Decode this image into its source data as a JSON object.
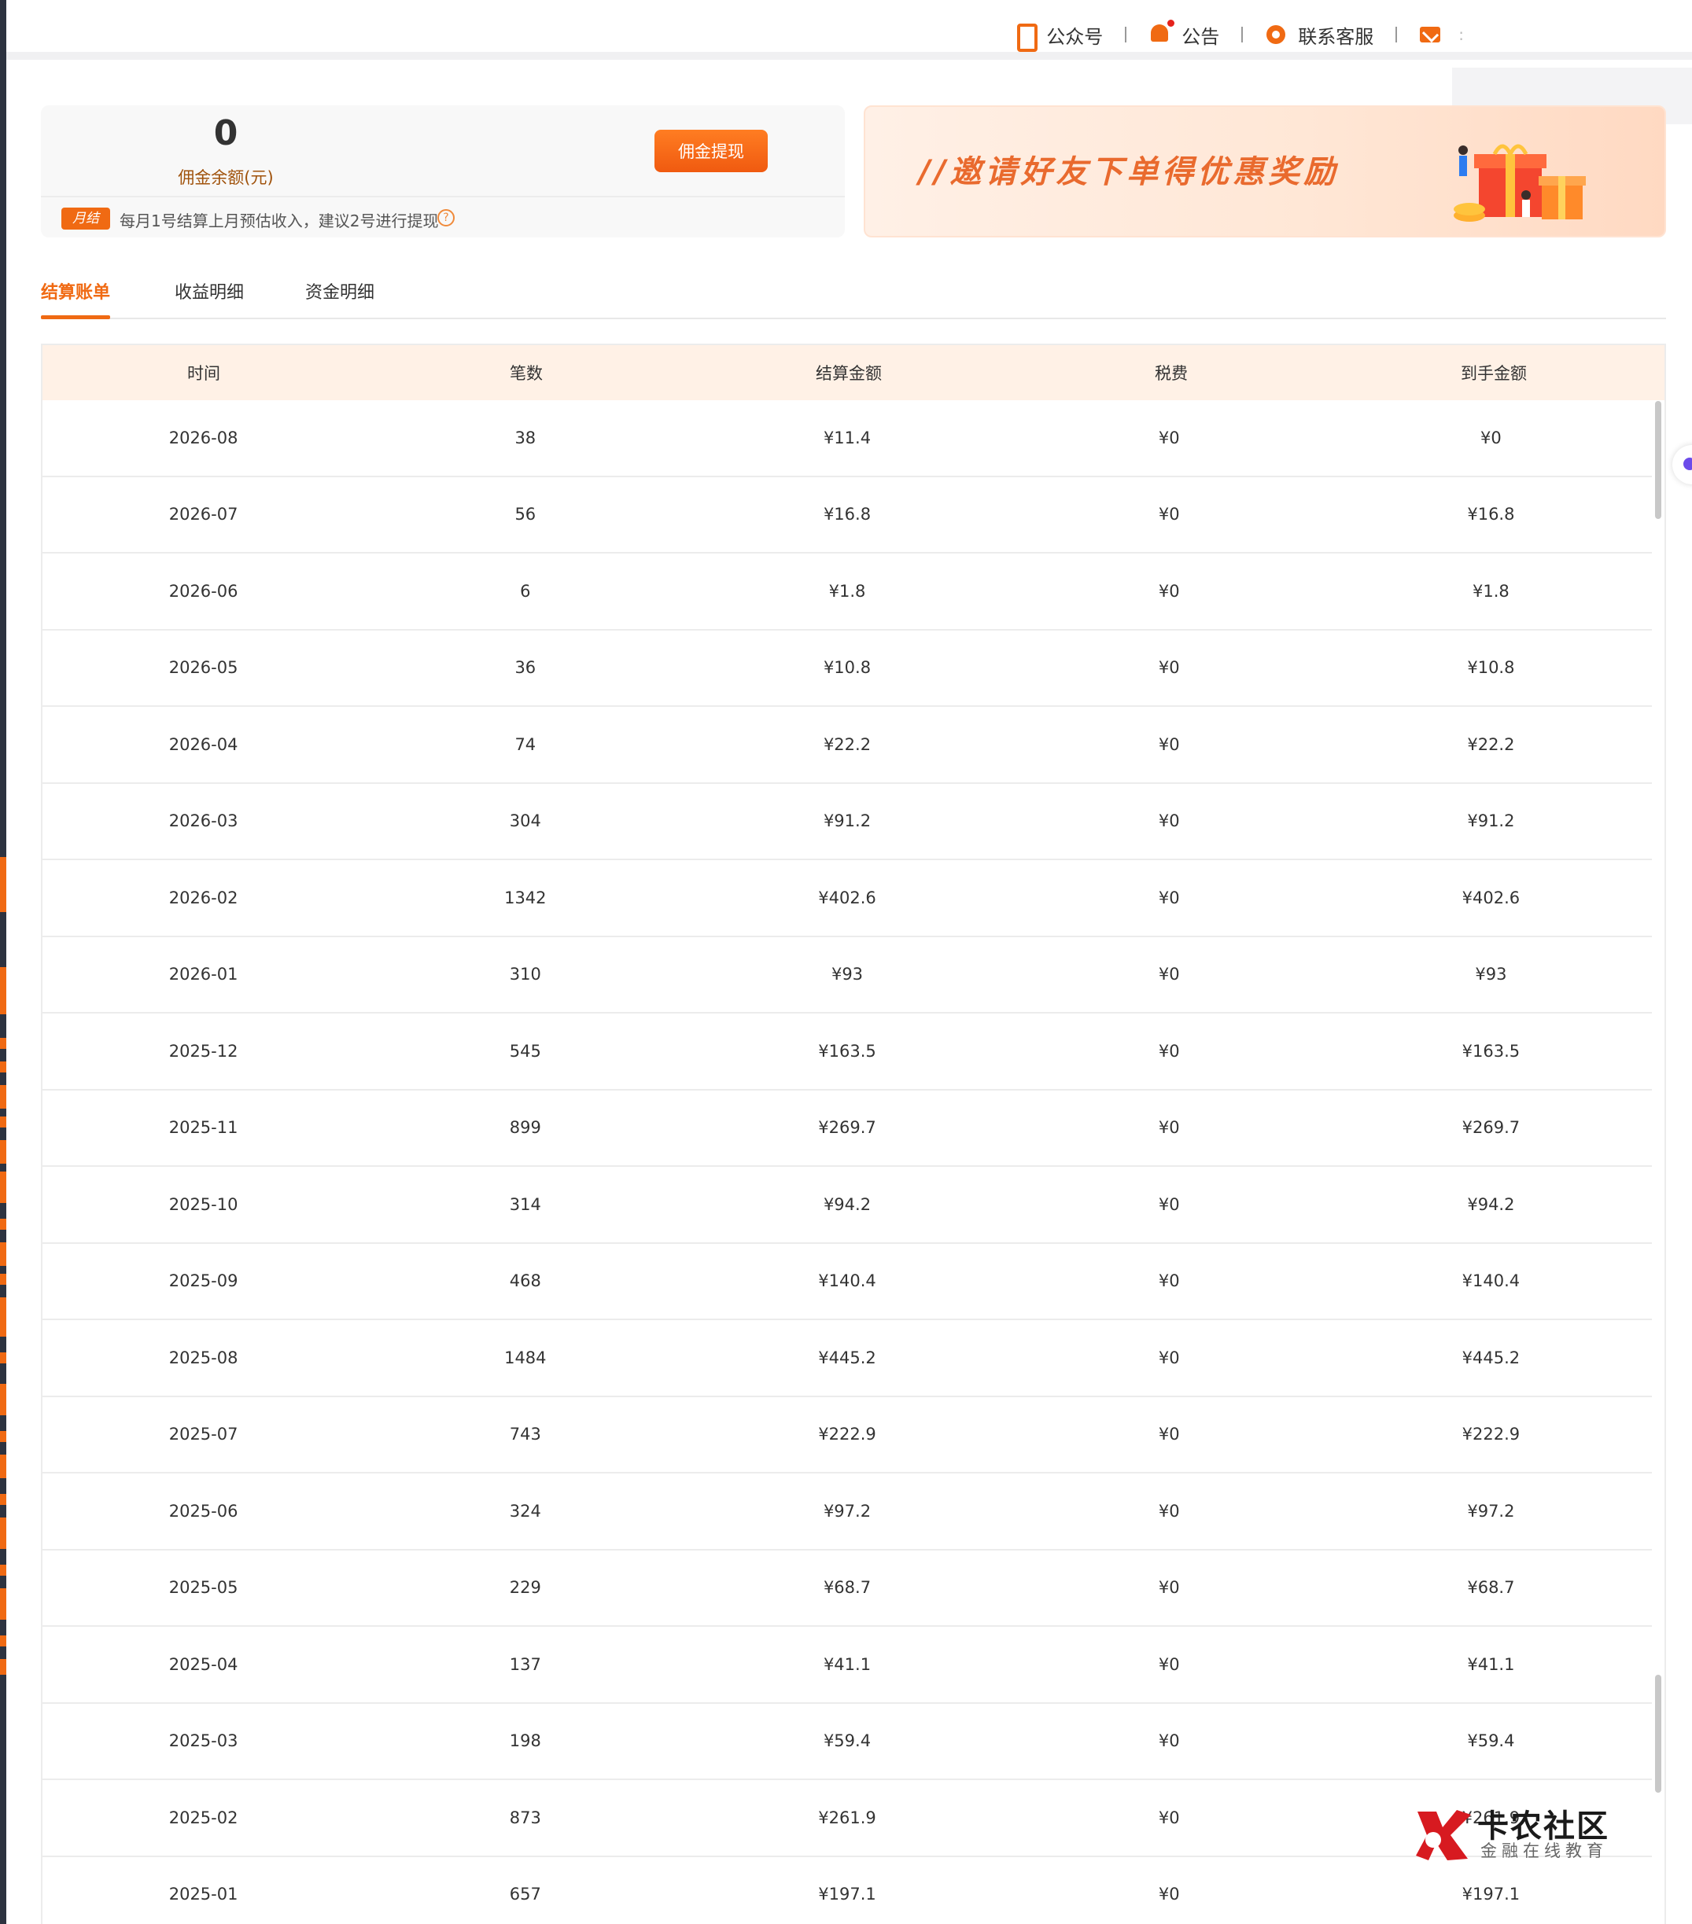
{
  "topnav": {
    "items": [
      {
        "label": "公众号",
        "icon": "phone-icon"
      },
      {
        "label": "公告",
        "icon": "bell-icon"
      },
      {
        "label": "联系客服",
        "icon": "customer-service-icon"
      },
      {
        "label": "",
        "icon": "mail-icon"
      }
    ],
    "trailing": ":"
  },
  "commission": {
    "balance": "0",
    "balance_label": "佣金余额(元)",
    "withdraw_label": "佣金提现",
    "monthly_tag": "月结",
    "monthly_note": "每月1号结算上月预估收入，建议2号进行提现",
    "help_symbol": "?"
  },
  "promo": {
    "text": "//邀请好友下单得优惠奖励"
  },
  "tabs": [
    {
      "label": "结算账单",
      "active": true
    },
    {
      "label": "收益明细",
      "active": false
    },
    {
      "label": "资金明细",
      "active": false
    }
  ],
  "table": {
    "headers": [
      "时间",
      "笔数",
      "结算金额",
      "税费",
      "到手金额"
    ],
    "rows": [
      [
        "2026-08",
        "38",
        "¥11.4",
        "¥0",
        "¥0"
      ],
      [
        "2026-07",
        "56",
        "¥16.8",
        "¥0",
        "¥16.8"
      ],
      [
        "2026-06",
        "6",
        "¥1.8",
        "¥0",
        "¥1.8"
      ],
      [
        "2026-05",
        "36",
        "¥10.8",
        "¥0",
        "¥10.8"
      ],
      [
        "2026-04",
        "74",
        "¥22.2",
        "¥0",
        "¥22.2"
      ],
      [
        "2026-03",
        "304",
        "¥91.2",
        "¥0",
        "¥91.2"
      ],
      [
        "2026-02",
        "1342",
        "¥402.6",
        "¥0",
        "¥402.6"
      ],
      [
        "2026-01",
        "310",
        "¥93",
        "¥0",
        "¥93"
      ],
      [
        "2025-12",
        "545",
        "¥163.5",
        "¥0",
        "¥163.5"
      ],
      [
        "2025-11",
        "899",
        "¥269.7",
        "¥0",
        "¥269.7"
      ],
      [
        "2025-10",
        "314",
        "¥94.2",
        "¥0",
        "¥94.2"
      ],
      [
        "2025-09",
        "468",
        "¥140.4",
        "¥0",
        "¥140.4"
      ],
      [
        "2025-08",
        "1484",
        "¥445.2",
        "¥0",
        "¥445.2"
      ],
      [
        "2025-07",
        "743",
        "¥222.9",
        "¥0",
        "¥222.9"
      ],
      [
        "2025-06",
        "324",
        "¥97.2",
        "¥0",
        "¥97.2"
      ],
      [
        "2025-05",
        "229",
        "¥68.7",
        "¥0",
        "¥68.7"
      ],
      [
        "2025-04",
        "137",
        "¥41.1",
        "¥0",
        "¥41.1"
      ],
      [
        "2025-03",
        "198",
        "¥59.4",
        "¥0",
        "¥59.4"
      ],
      [
        "2025-02",
        "873",
        "¥261.9",
        "¥0",
        "¥261.9"
      ],
      [
        "2025-01",
        "657",
        "¥197.1",
        "¥0",
        "¥197.1"
      ]
    ]
  },
  "watermark": {
    "title": "卡农社区",
    "subtitle": "金融在线教育"
  },
  "colors": {
    "accent": "#f06a13",
    "header_bg": "#fff1e6"
  }
}
